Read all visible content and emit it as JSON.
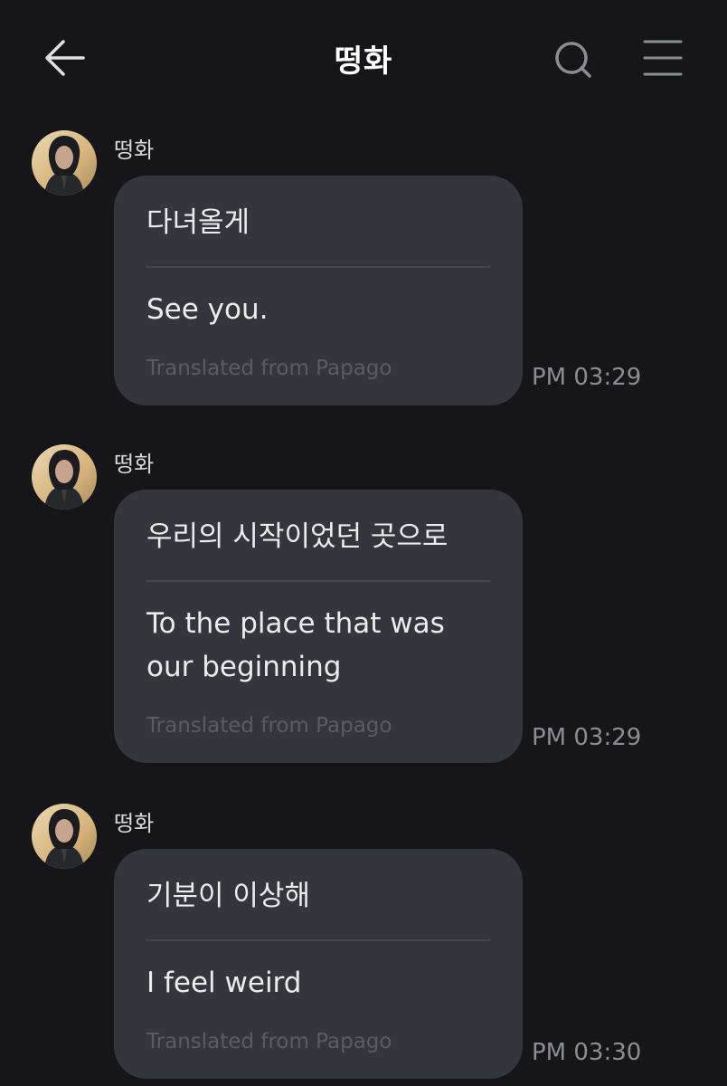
{
  "header": {
    "title": "떵화",
    "icons": {
      "back": "back-arrow-icon",
      "search": "search-icon",
      "menu": "menu-icon"
    }
  },
  "messages": [
    {
      "sender": "떵화",
      "original": "다녀올게",
      "translation": "See you.",
      "source": "Translated from Papago",
      "time": "PM 03:29"
    },
    {
      "sender": "떵화",
      "original": "우리의 시작이었던 곳으로",
      "translation": "To the place that was our beginning",
      "source": "Translated from Papago",
      "time": "PM 03:29"
    },
    {
      "sender": "떵화",
      "original": "기분이 이상해",
      "translation": "I feel weird",
      "source": "Translated from Papago",
      "time": "PM 03:30"
    }
  ],
  "colors": {
    "background": "#16161a",
    "bubble": "#34363c",
    "divider": "#45474e",
    "timestamp": "#8c8d93",
    "source_text": "#5a5c63"
  }
}
